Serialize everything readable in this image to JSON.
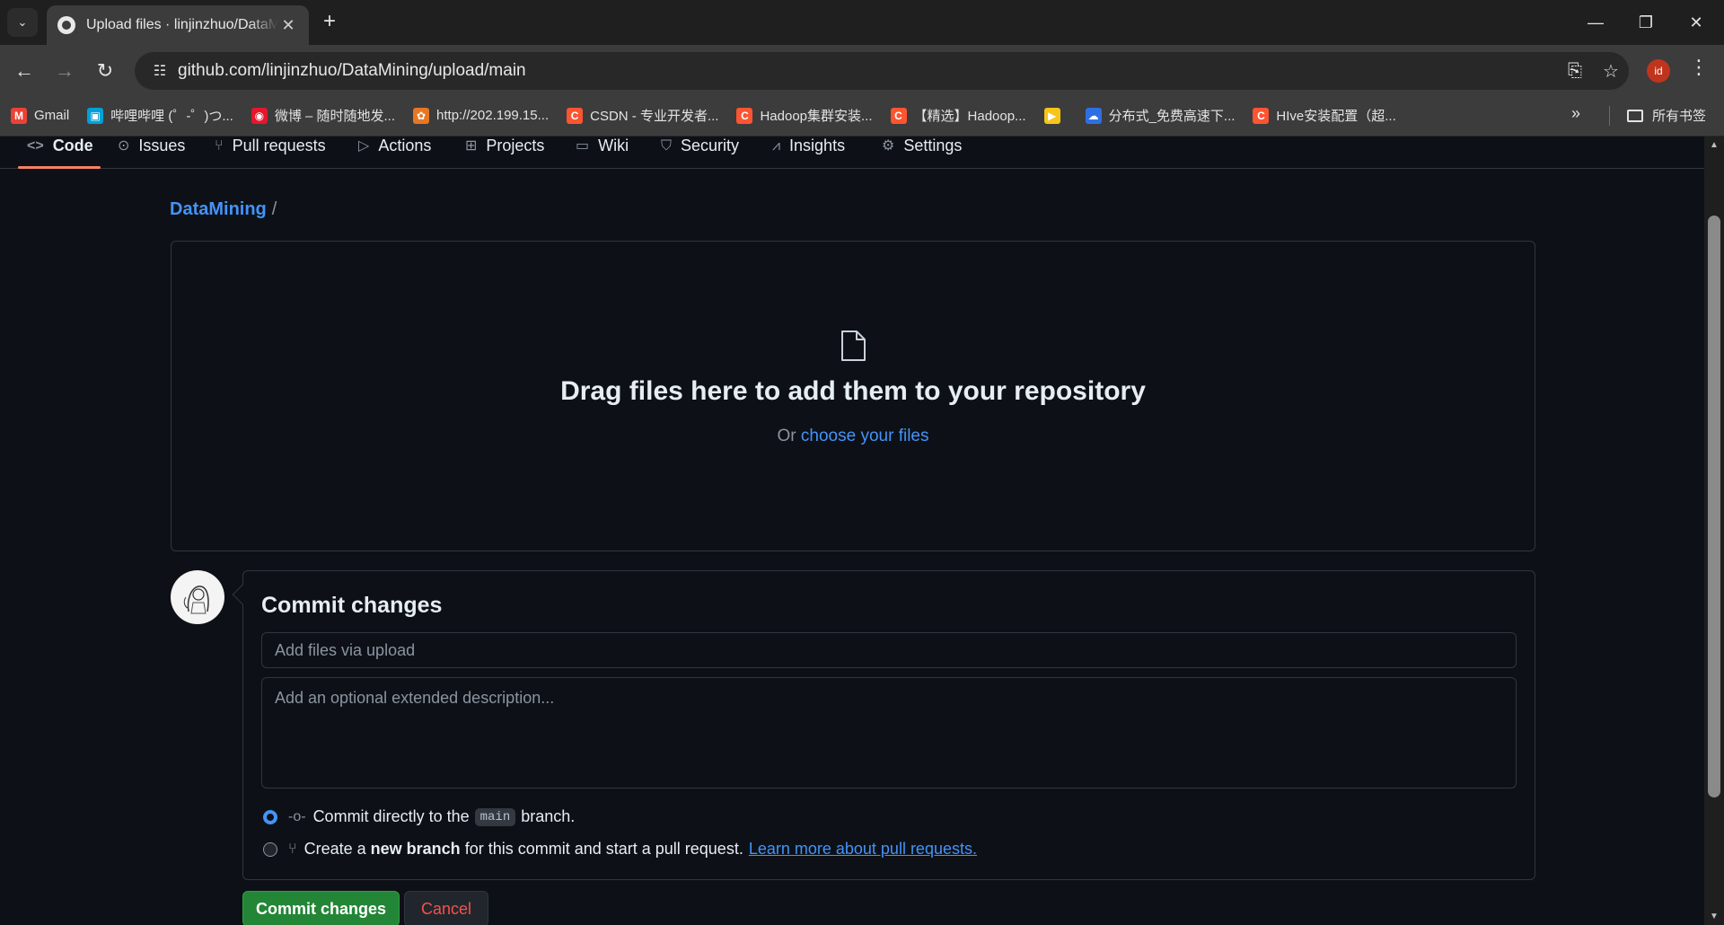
{
  "browser": {
    "tab_title": "Upload files · linjinzhuo/DataMining",
    "url": "github.com/linjinzhuo/DataMining/upload/main",
    "profile_initials": "id",
    "bookmarks": [
      {
        "label": "Gmail",
        "icon": "gmail-icon",
        "color": "#ea4335"
      },
      {
        "label": "哔哩哔哩 (゜-゜)つ...",
        "icon": "bilibili-icon",
        "color": "#00a1d6"
      },
      {
        "label": "微博 – 随时随地发...",
        "icon": "weibo-icon",
        "color": "#e6162d"
      },
      {
        "label": "http://202.199.15...",
        "icon": "site-icon",
        "color": "#e87722"
      },
      {
        "label": "CSDN - 专业开发者...",
        "icon": "csdn-icon",
        "color": "#fc5531"
      },
      {
        "label": "Hadoop集群安装...",
        "icon": "csdn-icon",
        "color": "#fc5531"
      },
      {
        "label": "【精选】Hadoop...",
        "icon": "csdn-icon",
        "color": "#fc5531"
      },
      {
        "label": "",
        "icon": "video-icon",
        "color": "#f5c518"
      },
      {
        "label": "分布式_免费高速下...",
        "icon": "baidu-icon",
        "color": "#2f6fe4"
      },
      {
        "label": "HIve安装配置（超...",
        "icon": "csdn-icon",
        "color": "#fc5531"
      }
    ],
    "bookmarks_folder": "所有书签"
  },
  "repo_nav": [
    {
      "label": "Code",
      "icon": "code-icon",
      "selected": true
    },
    {
      "label": "Issues",
      "icon": "issue-icon"
    },
    {
      "label": "Pull requests",
      "icon": "pull-request-icon"
    },
    {
      "label": "Actions",
      "icon": "play-icon"
    },
    {
      "label": "Projects",
      "icon": "table-icon"
    },
    {
      "label": "Wiki",
      "icon": "book-icon"
    },
    {
      "label": "Security",
      "icon": "shield-icon"
    },
    {
      "label": "Insights",
      "icon": "graph-icon"
    },
    {
      "label": "Settings",
      "icon": "gear-icon"
    }
  ],
  "breadcrumb": {
    "repo": "DataMining",
    "separator": "/"
  },
  "dropzone": {
    "title": "Drag files here to add them to your repository",
    "or_text": "Or",
    "choose_link": "choose your files"
  },
  "commit": {
    "title": "Commit changes",
    "summary_placeholder": "Add files via upload",
    "description_placeholder": "Add an optional extended description...",
    "option_direct_prefix": "Commit directly to the",
    "option_direct_branch": "main",
    "option_direct_suffix": "branch.",
    "option_new_prefix": "Create a",
    "option_new_bold": "new branch",
    "option_new_suffix": "for this commit and start a pull request.",
    "option_new_link": "Learn more about pull requests.",
    "submit_label": "Commit changes",
    "cancel_label": "Cancel"
  },
  "colors": {
    "accent": "#4493f8",
    "primary_button": "#238636",
    "danger": "#f85149",
    "background": "#0d1117"
  }
}
